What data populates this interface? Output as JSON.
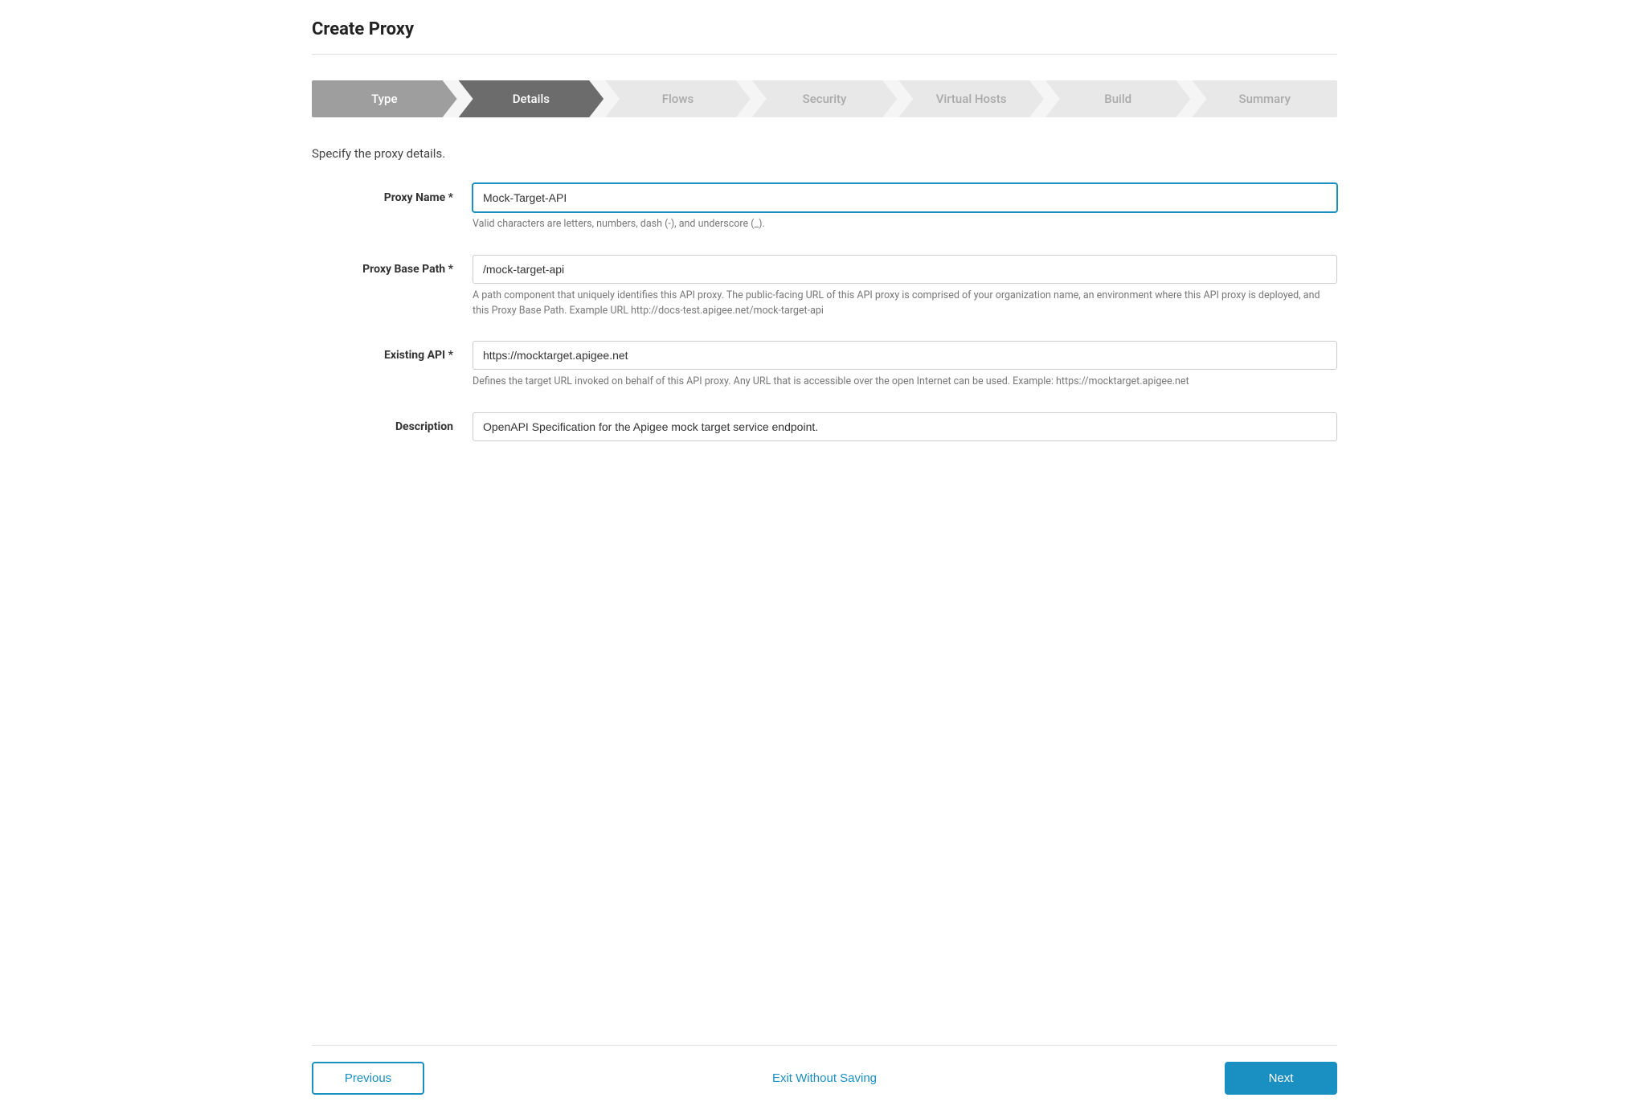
{
  "page": {
    "title": "Create Proxy",
    "subtitle": "Specify the proxy details."
  },
  "stepper": {
    "steps": [
      {
        "id": "type",
        "label": "Type",
        "state": "completed"
      },
      {
        "id": "details",
        "label": "Details",
        "state": "active"
      },
      {
        "id": "flows",
        "label": "Flows",
        "state": "inactive"
      },
      {
        "id": "security",
        "label": "Security",
        "state": "inactive"
      },
      {
        "id": "virtual-hosts",
        "label": "Virtual Hosts",
        "state": "inactive"
      },
      {
        "id": "build",
        "label": "Build",
        "state": "inactive"
      },
      {
        "id": "summary",
        "label": "Summary",
        "state": "inactive"
      }
    ]
  },
  "form": {
    "fields": [
      {
        "id": "proxy-name",
        "label": "Proxy Name",
        "required": true,
        "value": "Mock-Target-API",
        "hint": "Valid characters are letters, numbers, dash (-), and underscore (_).",
        "type": "text",
        "focused": true
      },
      {
        "id": "proxy-base-path",
        "label": "Proxy Base Path",
        "required": true,
        "value": "/mock-target-api",
        "hint": "A path component that uniquely identifies this API proxy. The public-facing URL of this API proxy is comprised of your organization name, an environment where this API proxy is deployed, and this Proxy Base Path. Example URL http://docs-test.apigee.net/mock-target-api",
        "type": "text",
        "focused": false
      },
      {
        "id": "existing-api",
        "label": "Existing API",
        "required": true,
        "value": "https://mocktarget.apigee.net",
        "hint": "Defines the target URL invoked on behalf of this API proxy. Any URL that is accessible over the open Internet can be used. Example: https://mocktarget.apigee.net",
        "type": "text",
        "focused": false
      },
      {
        "id": "description",
        "label": "Description",
        "required": false,
        "value": "OpenAPI Specification for the Apigee mock target service endpoint.",
        "hint": "",
        "type": "text",
        "focused": false
      }
    ]
  },
  "footer": {
    "previous_label": "Previous",
    "exit_label": "Exit Without Saving",
    "next_label": "Next"
  }
}
